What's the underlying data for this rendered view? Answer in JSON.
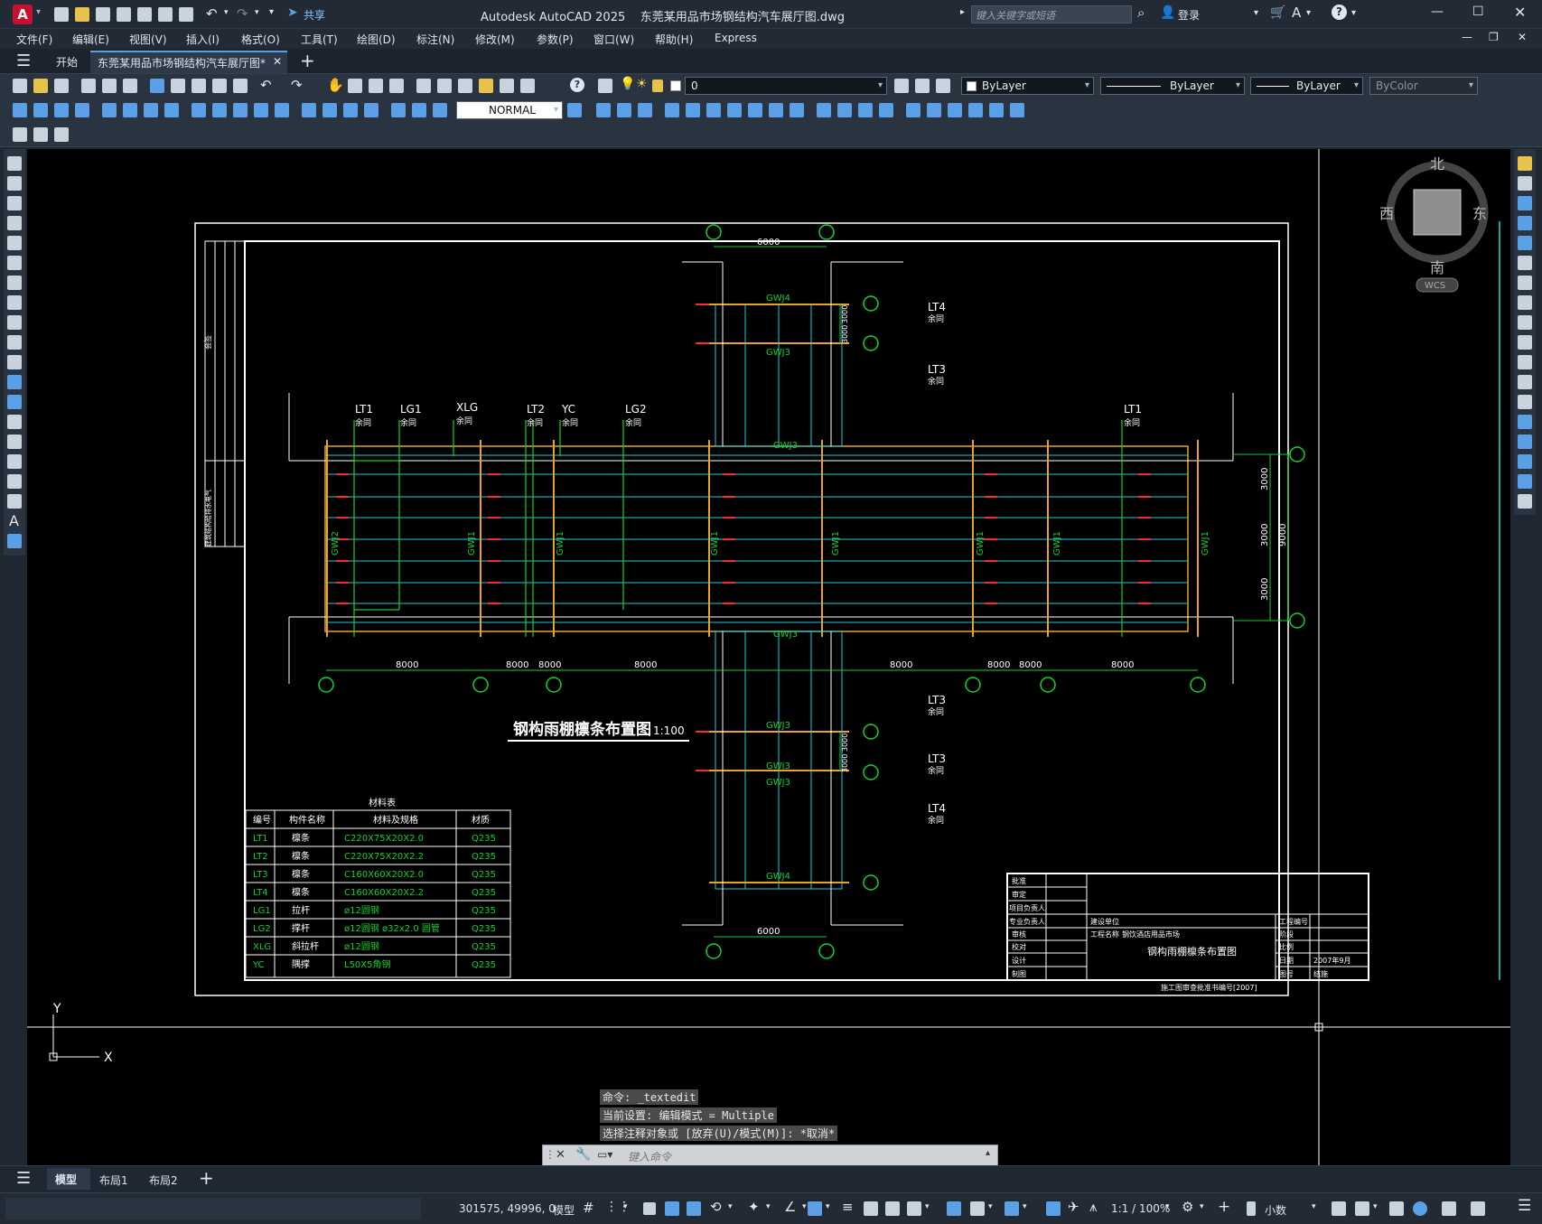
{
  "app": {
    "title": "Autodesk AutoCAD 2025",
    "filename": "东莞某用品市场钢结构汽车展厅图.dwg",
    "search_placeholder": "键入关键字或短语",
    "login_label": "登录",
    "share_label": "共享",
    "logo_letter": "A"
  },
  "menu": [
    "文件(F)",
    "编辑(E)",
    "视图(V)",
    "插入(I)",
    "格式(O)",
    "工具(T)",
    "绘图(D)",
    "标注(N)",
    "修改(M)",
    "参数(P)",
    "窗口(W)",
    "帮助(H)",
    "Express"
  ],
  "tabs": {
    "start": "开始",
    "doc": "东莞某用品市场钢结构汽车展厅图*",
    "add": "+"
  },
  "toolbar": {
    "layer_value": "0",
    "color_value": "ByLayer",
    "linetype_value": "ByLayer",
    "lineweight_value": "ByLayer",
    "plotstyle_value": "ByColor",
    "dimstyle_value": "NORMAL"
  },
  "viewcube": {
    "north": "北",
    "south": "南",
    "east": "东",
    "west": "西",
    "wcs": "WCS"
  },
  "ucs": {
    "x": "X",
    "y": "Y"
  },
  "drawing": {
    "title": "钢构雨棚檩条布置图",
    "scale": "1:100",
    "purlin_labels": [
      "LT1",
      "LG1",
      "XLG",
      "LT2",
      "YC",
      "LG2",
      "LT1"
    ],
    "purlin_sub": "余同",
    "right_labels": [
      "LT4",
      "LT3",
      "LT3",
      "LT3",
      "LT4"
    ],
    "truss_labels": [
      "GWJ4",
      "GWJ3",
      "GWJ3",
      "GWJ3",
      "GWJ3",
      "GWJ3",
      "GWJ3",
      "GWJ4"
    ],
    "col_labels": [
      "GWJ2",
      "GWJ1",
      "GWJ1",
      "GWJ1",
      "GWJ1",
      "GWJ1",
      "GWJ1",
      "GWJ1"
    ],
    "bottom_dims": [
      "8000",
      "8000",
      "8000",
      "8000",
      "8000",
      "8000",
      "8000",
      "8000"
    ],
    "top_dim": "6000",
    "bottom_dim": "6000",
    "side_dims": [
      "3000",
      "3000",
      "3000"
    ],
    "side_total": "9000",
    "vert_dims": [
      "3000",
      "3000",
      "3000",
      "3000"
    ]
  },
  "material_table": {
    "caption": "材料表",
    "headers": [
      "编号",
      "构件名称",
      "材料及规格",
      "材质"
    ],
    "rows": [
      [
        "LT1",
        "檩条",
        "C220X75X20X2.0",
        "Q235"
      ],
      [
        "LT2",
        "檩条",
        "C220X75X20X2.2",
        "Q235"
      ],
      [
        "LT3",
        "檩条",
        "C160X60X20X2.0",
        "Q235"
      ],
      [
        "LT4",
        "檩条",
        "C160X60X20X2.2",
        "Q235"
      ],
      [
        "LG1",
        "拉杆",
        "ø12圆钢",
        "Q235"
      ],
      [
        "LG2",
        "撑杆",
        "ø12圆钢 ø32x2.0 圆管",
        "Q235"
      ],
      [
        "XLG",
        "斜拉杆",
        "ø12圆钢",
        "Q235"
      ],
      [
        "YC",
        "隅撑",
        "L50X5角钢",
        "Q235"
      ]
    ]
  },
  "title_block": {
    "rows": [
      "批准",
      "审定",
      "项目负责人",
      "专业负责人",
      "审核",
      "校对",
      "设计",
      "制图"
    ],
    "unit_label": "建设单位",
    "project_label": "工程名称",
    "project_value": "钢饮酒店用品市场",
    "project_no_label": "工程编号",
    "drawing_name": "钢构雨棚檩条布置图",
    "stage": "阶段",
    "scale_label": "比例",
    "date_label": "日期",
    "date_value": "2007年9月",
    "sheet_label": "图号",
    "sheet_value": "结施",
    "footer": "施工图审查批准书编号[2007]",
    "side_label": "会签",
    "side_stack": "建筑结构给排水电气"
  },
  "command": {
    "line1": "命令: _textedit",
    "line2": "当前设置: 编辑模式 = Multiple",
    "line3": "选择注释对象或 [放弃(U)/模式(M)]: *取消*",
    "input_placeholder": "键入命令"
  },
  "layouts": [
    "模型",
    "布局1",
    "布局2"
  ],
  "status": {
    "coords": "301575, 49996, 0",
    "model": "模型",
    "scale": "1:1 / 100%",
    "units": "小数"
  }
}
